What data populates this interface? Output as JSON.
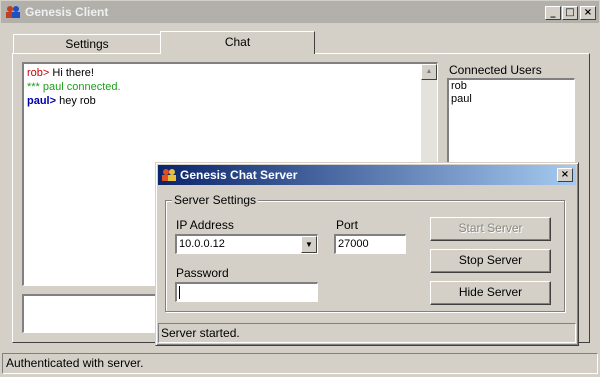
{
  "window": {
    "title": "Genesis Client",
    "minimize_glyph": "_",
    "maximize_glyph": "□",
    "close_glyph": "×"
  },
  "tabs": [
    {
      "label": "Settings",
      "selected": false
    },
    {
      "label": "Chat",
      "selected": true
    }
  ],
  "chat": {
    "lines": [
      {
        "nick": "rob>",
        "text": " Hi there!"
      },
      {
        "system": "*** paul connected."
      },
      {
        "nick": "paul>",
        "text": " hey rob"
      }
    ],
    "input_value": ""
  },
  "users": {
    "label": "Connected Users",
    "items": [
      "rob",
      "paul"
    ]
  },
  "status": "Authenticated with server.",
  "dialog": {
    "title": "Genesis Chat Server",
    "close_glyph": "×",
    "group_label": "Server Settings",
    "ip_label": "IP Address",
    "ip_value": "10.0.0.12",
    "port_label": "Port",
    "port_value": "27000",
    "password_label": "Password",
    "password_value": "",
    "start_button": "Start Server",
    "stop_button": "Stop Server",
    "hide_button": "Hide Server",
    "status": "Server started."
  },
  "colors": {
    "rob": "#cc0000",
    "paul": "#0000aa",
    "system": "#1e9e1e",
    "active_title": "#0a246a"
  },
  "icons": {
    "app": "users-icon",
    "combo": "chevron-down-icon",
    "scroll": "arrow-up-icon"
  }
}
